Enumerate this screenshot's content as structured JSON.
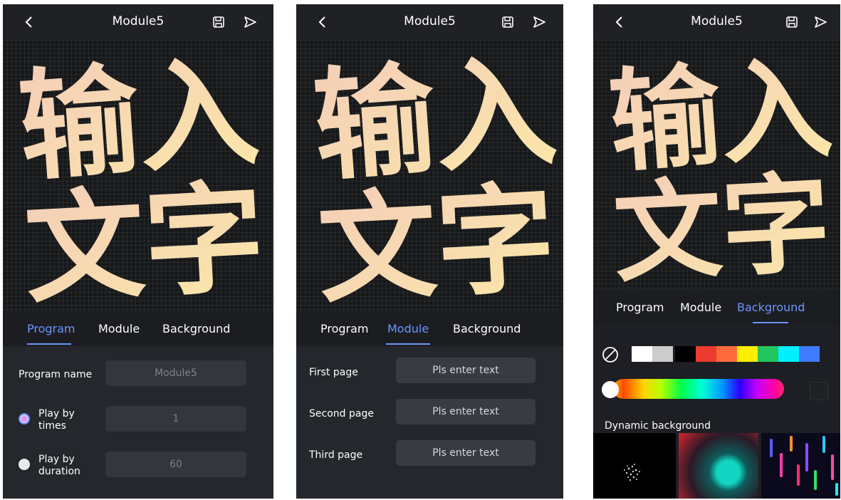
{
  "header": {
    "title": "Module5"
  },
  "canvas_text": {
    "line1": "输入",
    "line2": "文字"
  },
  "tabs": [
    {
      "label": "Program"
    },
    {
      "label": "Module"
    },
    {
      "label": "Background"
    }
  ],
  "program_panel": {
    "program_name_label": "Program name",
    "program_name_placeholder": "Module5",
    "play_by_times_label_1": "Play by",
    "play_by_times_label_2": "times",
    "play_by_times_value": "1",
    "play_by_duration_label_1": "Play by",
    "play_by_duration_label_2": "duration",
    "play_by_duration_value": "60",
    "selected_mode": "times"
  },
  "module_panel": {
    "pages": [
      {
        "label": "First page",
        "placeholder": "Pls enter text"
      },
      {
        "label": "Second page",
        "placeholder": "Pls enter text"
      },
      {
        "label": "Third page",
        "placeholder": "Pls enter text"
      }
    ]
  },
  "background_panel": {
    "swatches": [
      "#ffffff",
      "#cccccc",
      "#000000",
      "#ee3b2f",
      "#ff6a3c",
      "#ffee00",
      "#22c55e",
      "#00f0ff",
      "#3f7bff"
    ],
    "slider_fraction": 0.0,
    "dynamic_label": "Dynamic background"
  },
  "icons": {
    "back": "chevron-left-icon",
    "save": "save-icon",
    "send": "send-icon",
    "none": "no-color-icon"
  },
  "colors": {
    "accent": "#6c95ff",
    "text_gradient_start": "#f5d0c0",
    "text_gradient_end": "#fbe7a6"
  }
}
